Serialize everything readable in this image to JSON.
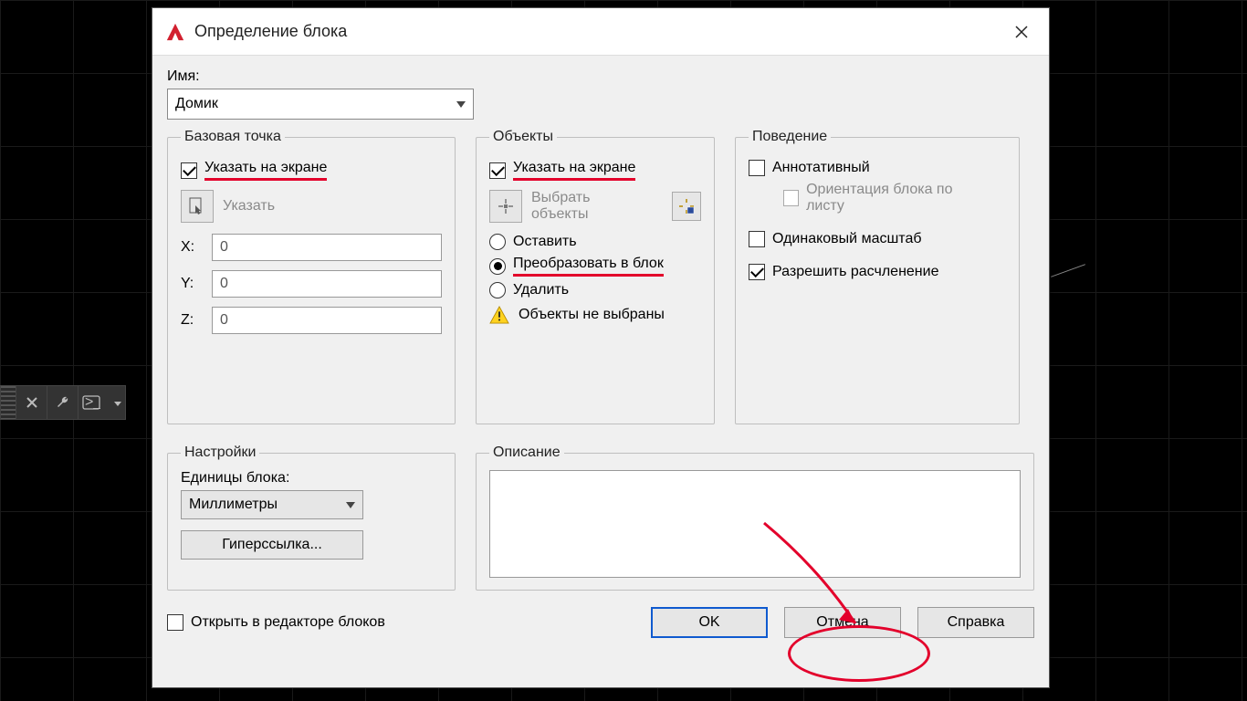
{
  "title": "Определение блока",
  "name_label": "Имя:",
  "name_value": "Домик",
  "groups": {
    "base": {
      "legend": "Базовая точка",
      "specify_on_screen": "Указать на экране",
      "pick_btn": "Указать",
      "x_label": "X:",
      "x_val": "0",
      "y_label": "Y:",
      "y_val": "0",
      "z_label": "Z:",
      "z_val": "0"
    },
    "objects": {
      "legend": "Объекты",
      "specify_on_screen": "Указать на экране",
      "select_btn": "Выбрать объекты",
      "retain": "Оставить",
      "convert": "Преобразовать в блок",
      "delete": "Удалить",
      "none_selected": "Объекты не выбраны"
    },
    "behavior": {
      "legend": "Поведение",
      "annotative": "Аннотативный",
      "match_orient": "Ориентация блока по листу",
      "uniform_scale": "Одинаковый масштаб",
      "allow_explode": "Разрешить расчленение"
    }
  },
  "settings": {
    "legend": "Настройки",
    "units_label": "Единицы блока:",
    "units_value": "Миллиметры",
    "hyperlink": "Гиперссылка..."
  },
  "description": {
    "legend": "Описание",
    "value": ""
  },
  "open_editor": "Открыть в редакторе блоков",
  "buttons": {
    "ok": "OK",
    "cancel": "Отмена",
    "help": "Справка"
  }
}
